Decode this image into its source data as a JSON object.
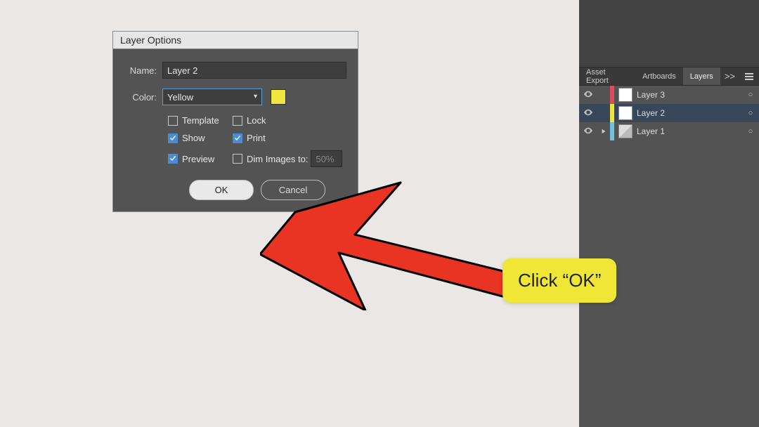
{
  "dialog": {
    "title": "Layer Options",
    "name_label": "Name:",
    "name_value": "Layer 2",
    "color_label": "Color:",
    "color_value": "Yellow",
    "swatch_hex": "#f0e43e",
    "checkboxes": {
      "template": {
        "label": "Template",
        "checked": false
      },
      "lock": {
        "label": "Lock",
        "checked": false
      },
      "show": {
        "label": "Show",
        "checked": true
      },
      "print": {
        "label": "Print",
        "checked": true
      },
      "preview": {
        "label": "Preview",
        "checked": true
      },
      "dim": {
        "label": "Dim Images to:",
        "checked": false,
        "value": "50%"
      }
    },
    "ok_label": "OK",
    "cancel_label": "Cancel"
  },
  "panel": {
    "tabs": {
      "asset": "Asset Export",
      "artboards": "Artboards",
      "layers": "Layers",
      "expand": ">>"
    },
    "layers": [
      {
        "name": "Layer 3",
        "color": "#e04a5e",
        "thumb": "blank"
      },
      {
        "name": "Layer 2",
        "color": "#f0e43e",
        "thumb": "blank"
      },
      {
        "name": "Layer 1",
        "color": "#6fc3e0",
        "thumb": "img"
      }
    ]
  },
  "annotation": {
    "text": "Click “OK”"
  }
}
